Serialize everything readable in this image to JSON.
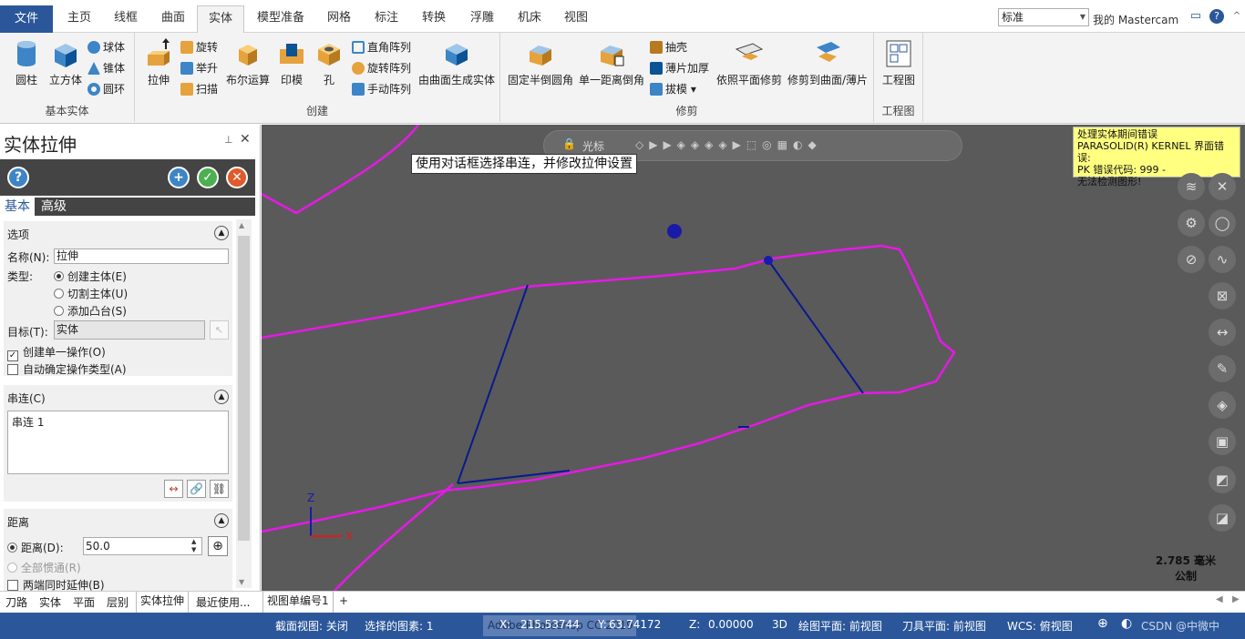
{
  "menu_tabs": {
    "file": "文件",
    "home": "主页",
    "wireframe": "线框",
    "surfaces": "曲面",
    "solids": "实体",
    "model_prep": "模型准备",
    "mesh": "网格",
    "annotate": "标注",
    "transform": "转换",
    "relief": "浮雕",
    "machine": "机床",
    "view": "视图"
  },
  "workspace_combo": "标准",
  "my_mastercam": "我的 Mastercam",
  "ribbon": {
    "basic": {
      "label": "基本实体",
      "cylinder": "圆柱",
      "block": "立方体",
      "sphere": "球体",
      "cone": "锥体",
      "torus": "圆环"
    },
    "create": {
      "label": "创建",
      "extrude": "拉伸",
      "revolve": "旋转",
      "lift": "举升",
      "sweep": "扫描",
      "boolean": "布尔运算",
      "impression": "印模",
      "hole": "孔",
      "rect_pattern": "直角阵列",
      "rot_pattern": "旋转阵列",
      "manual_pattern": "手动阵列",
      "from_surfaces": "由曲面生成实体"
    },
    "modify": {
      "label": "修剪",
      "const_fillet": "固定半倒圆角",
      "one_chamfer": "单一距离倒角",
      "shell": "抽壳",
      "thicken": "薄片加厚",
      "draft": "拔模",
      "trim_plane": "依照平面修剪",
      "trim_surface": "修剪到曲面/薄片"
    },
    "drawing": {
      "label": "工程图",
      "layout": "工程图"
    }
  },
  "panel": {
    "title": "实体拉伸",
    "tab_basic": "基本",
    "tab_advanced": "高级",
    "options": "选项",
    "name_label": "名称(N):",
    "name_value": "拉伸",
    "type_label": "类型:",
    "type_create": "创建主体(E)",
    "type_cut": "切割主体(U)",
    "type_boss": "添加凸台(S)",
    "target_label": "目标(T):",
    "target_value": "实体",
    "single_op": "创建单一操作(O)",
    "auto_type": "自动确定操作类型(A)",
    "chain_section": "串连(C)",
    "chain_item": "串连 1",
    "distance_section": "距离",
    "distance_label": "距离(D):",
    "distance_value": "50.0",
    "through_all": "全部惯通(R)",
    "both_dir": "两端同时延伸(B)"
  },
  "manager_tabs": {
    "toolpaths": "刀路",
    "solids": "实体",
    "planes": "平面",
    "levels": "层别",
    "extrude": "实体拉伸",
    "recent": "最近使用..."
  },
  "viewport_tab": "视图单编号1",
  "viewport_tab_add": "+",
  "quick_toolbar_label": "光标",
  "tooltip": "使用对话框选择串连，并修改拉伸设置",
  "error_box": [
    "处理实体期间错误",
    "PARASOLID(R) KERNEL 界面错误:",
    "PK 错误代码: 999 -",
    "无法检测图形!"
  ],
  "scale": {
    "value": "2.785 毫米",
    "unit": "公制"
  },
  "axis_labels": {
    "z": "Z",
    "x": "X"
  },
  "status": {
    "section_view": "截面视图: 关闭",
    "selected": "选择的图素: 1",
    "x_label": "X:",
    "x_value": "215.53744",
    "y_label": "Y:",
    "y_value": "63.74172",
    "z_label": "Z:",
    "z_value": "0.00000",
    "mode": "3D",
    "cplane": "绘图平面: 前视图",
    "tplane": "刀具平面: 前视图",
    "wcs": "WCS: 俯视图",
    "overlay": "Adobe Photoshop CC 2019",
    "watermark": "CSDN @中微中"
  },
  "colors": {
    "accent": "#2b579a",
    "geometry": "#e619e6",
    "lines": "#0a1a8c",
    "viewport": "#5a5a5a"
  }
}
